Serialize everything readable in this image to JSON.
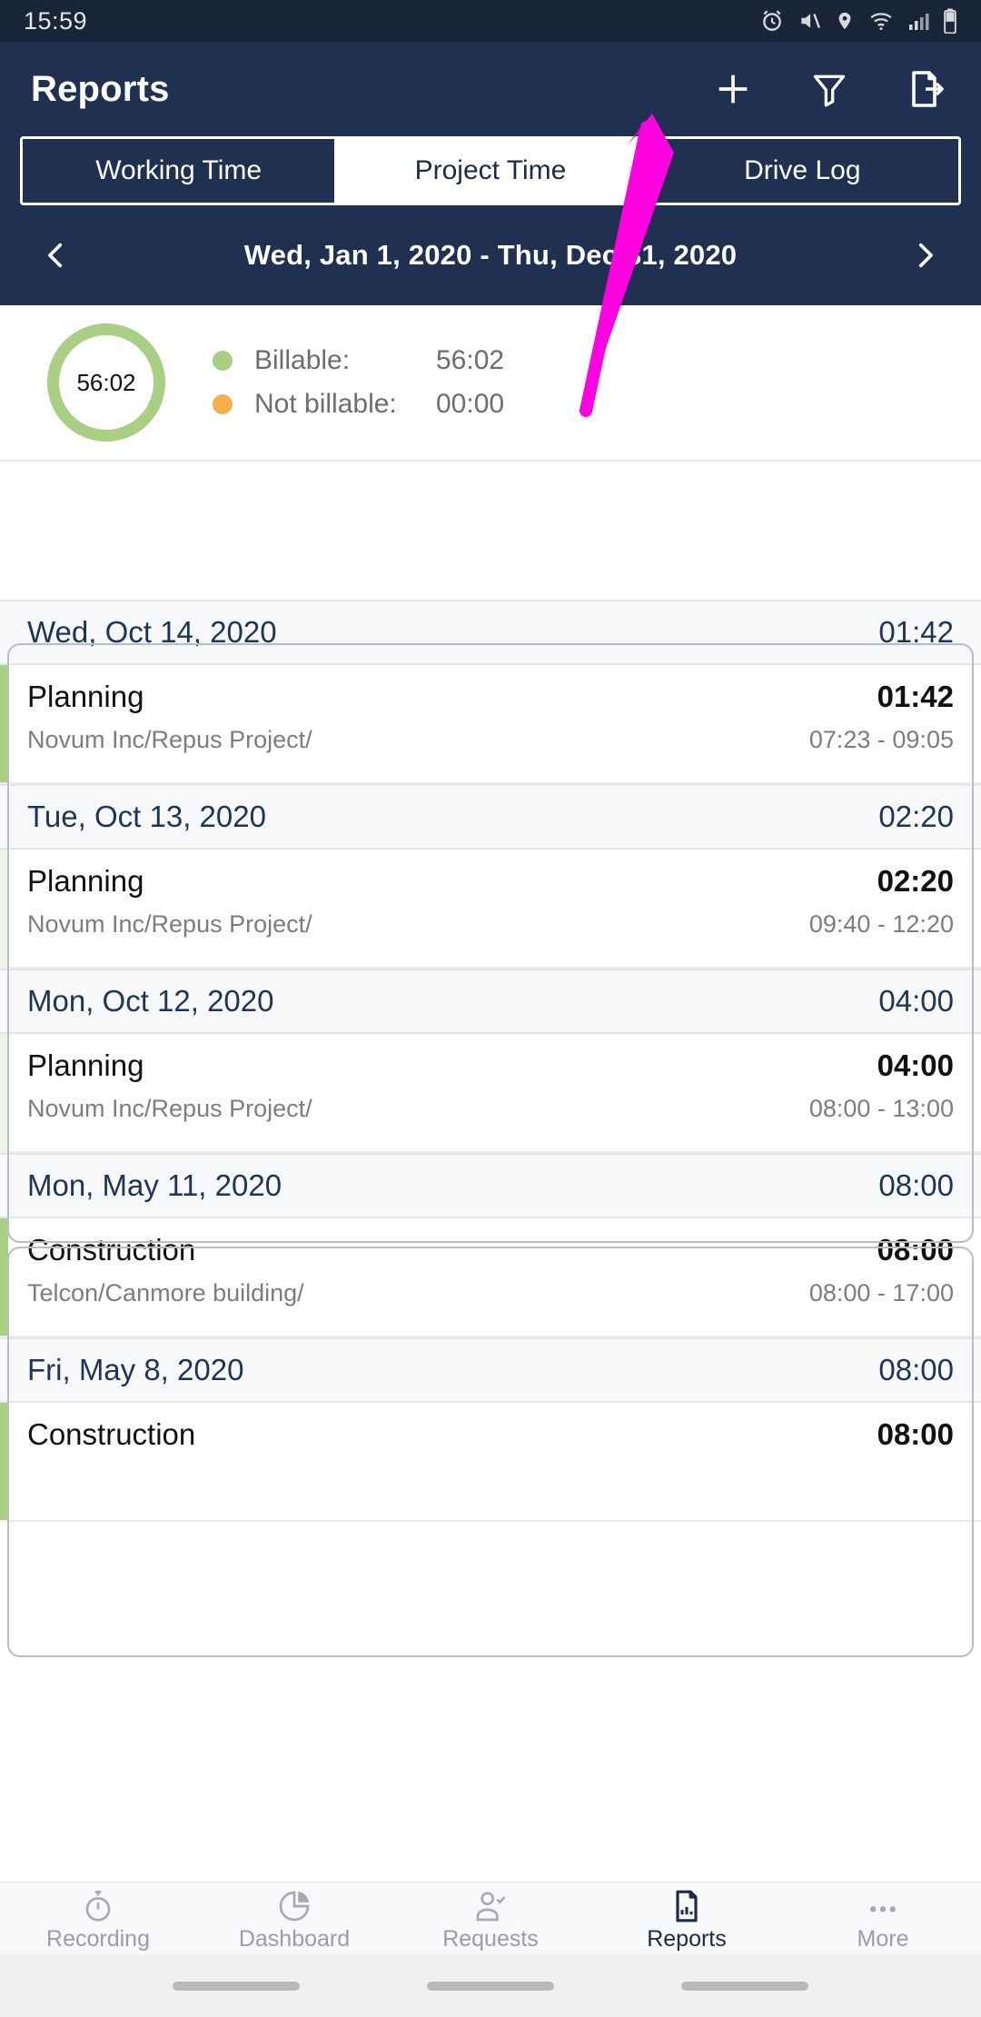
{
  "status_bar": {
    "time": "15:59",
    "icons": [
      "alarm-icon",
      "mute-icon",
      "location-icon",
      "wifi-icon",
      "signal-icon",
      "battery-icon"
    ]
  },
  "app_bar": {
    "title": "Reports",
    "actions": [
      {
        "name": "add-icon",
        "label": "+"
      },
      {
        "name": "filter-icon",
        "label": "Filter"
      },
      {
        "name": "export-icon",
        "label": "Export"
      }
    ]
  },
  "tabs": [
    {
      "label": "Working Time",
      "active": false
    },
    {
      "label": "Project Time",
      "active": true
    },
    {
      "label": "Drive Log",
      "active": false
    }
  ],
  "date_nav": {
    "prev": "‹",
    "range": "Wed, Jan 1, 2020 - Thu, Dec 31, 2020",
    "next": "›"
  },
  "summary": {
    "total": "56:02",
    "billable_label": "Billable:",
    "billable_value": "56:02",
    "not_billable_label": "Not billable:",
    "not_billable_value": "00:00",
    "billable_color": "#a6cf7e",
    "not_billable_color": "#f5b04b"
  },
  "list": [
    {
      "type": "day",
      "date": "Wed, Oct 14, 2020",
      "total": "01:42"
    },
    {
      "type": "entry",
      "title": "Planning",
      "duration": "01:42",
      "project": "Novum Inc/Repus Project/",
      "time_range": "07:23 - 09:05"
    },
    {
      "type": "day",
      "date": "Tue, Oct 13, 2020",
      "total": "02:20"
    },
    {
      "type": "entry",
      "title": "Planning",
      "duration": "02:20",
      "project": "Novum Inc/Repus Project/",
      "time_range": "09:40 - 12:20"
    },
    {
      "type": "day",
      "date": "Mon, Oct 12, 2020",
      "total": "04:00"
    },
    {
      "type": "entry",
      "title": "Planning",
      "duration": "04:00",
      "project": "Novum Inc/Repus Project/",
      "time_range": "08:00 - 13:00"
    },
    {
      "type": "day",
      "date": "Mon, May 11, 2020",
      "total": "08:00"
    },
    {
      "type": "entry",
      "title": "Construction",
      "duration": "08:00",
      "project": "Telcon/Canmore building/",
      "time_range": "08:00 - 17:00"
    },
    {
      "type": "day",
      "date": "Fri, May 8, 2020",
      "total": "08:00"
    },
    {
      "type": "entry",
      "title": "Construction",
      "duration": "08:00",
      "project": "",
      "time_range": ""
    }
  ],
  "bottom_nav": [
    {
      "label": "Recording",
      "icon": "stopwatch-icon",
      "active": false
    },
    {
      "label": "Dashboard",
      "icon": "pie-chart-icon",
      "active": false
    },
    {
      "label": "Requests",
      "icon": "person-check-icon",
      "active": false
    },
    {
      "label": "Reports",
      "icon": "document-chart-icon",
      "active": true
    },
    {
      "label": "More",
      "icon": "ellipsis-icon",
      "active": false
    }
  ],
  "theme": {
    "header_bg": "#203050",
    "accent_green": "#a9cf83",
    "accent_orange": "#f5b04b",
    "navy_text": "#1d3557",
    "annotation_color": "#ff00e0"
  }
}
